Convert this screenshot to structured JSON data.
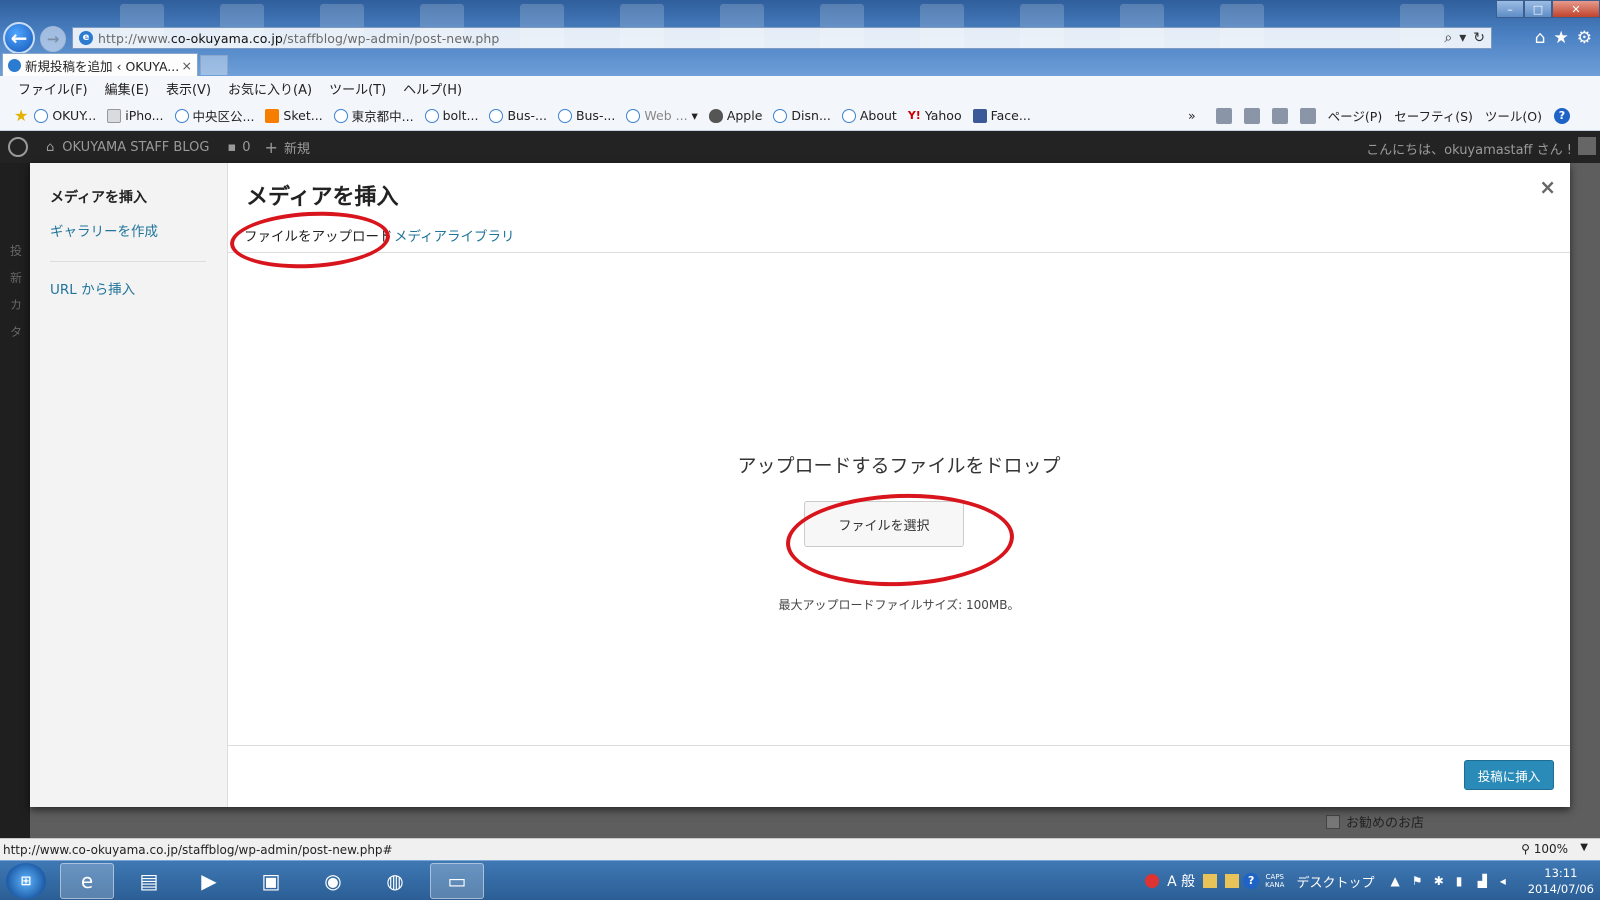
{
  "browser": {
    "address_url_prefix": "http://www.",
    "address_url_domain": "co-okuyama.co.jp",
    "address_url_path": "/staffblog/wp-admin/post-new.php",
    "tab_title": "新規投稿を追加 ‹ OKUYA...",
    "tab_close": "×",
    "window_buttons": [
      "–",
      "□",
      "✕"
    ],
    "menu": [
      "ファイル(F)",
      "編集(E)",
      "表示(V)",
      "お気に入り(A)",
      "ツール(T)",
      "ヘルプ(H)"
    ],
    "favorites": [
      {
        "label": "OKUY...",
        "icon": "ie-page-icon"
      },
      {
        "label": "iPho...",
        "icon": "document-icon"
      },
      {
        "label": "中央区公...",
        "icon": "ie-page-icon"
      },
      {
        "label": "Sket...",
        "icon": "blogger-icon"
      },
      {
        "label": "東京都中...",
        "icon": "ie-page-icon"
      },
      {
        "label": "bolt...",
        "icon": "ie-page-icon"
      },
      {
        "label": "Bus-...",
        "icon": "ie-page-icon"
      },
      {
        "label": "Bus-...",
        "icon": "ie-page-icon"
      },
      {
        "label": "Web ...",
        "icon": "ie-page-icon"
      },
      {
        "label": "Apple",
        "icon": "apple-icon"
      },
      {
        "label": "Disn...",
        "icon": "ie-page-icon"
      },
      {
        "label": "About",
        "icon": "ie-page-icon"
      },
      {
        "label": "Yahoo",
        "icon": "yahoo-icon"
      },
      {
        "label": "Face...",
        "icon": "facebook-icon"
      }
    ],
    "toolbar_right": {
      "page": "ページ(P)",
      "safety": "セーフティ(S)",
      "tools": "ツール(O)",
      "more": "»"
    },
    "status_url": "http://www.co-okuyama.co.jp/staffblog/wp-admin/post-new.php#",
    "zoom": "100%"
  },
  "wp_admin_bar": {
    "site_name": "OKUYAMA STAFF BLOG",
    "comments_count": "0",
    "new_label": "新規",
    "howdy": "こんにちは、okuyamastaff さん !"
  },
  "wp_sidebar_partial": [
    "投",
    "新",
    "カ",
    "タ"
  ],
  "background": {
    "checkbox_label": "お勧めのお店"
  },
  "media_modal": {
    "menu_title": "メディアを挿入",
    "menu_gallery": "ギャラリーを作成",
    "menu_url": "URL から挿入",
    "title": "メディアを挿入",
    "close": "×",
    "tab_upload": "ファイルをアップロード",
    "tab_library": "メディアライブラリ",
    "drop_text": "アップロードするファイルをドロップ",
    "select_button": "ファイルを選択",
    "max_size": "最大アップロードファイルサイズ: 100MB。",
    "insert_button": "投稿に挿入"
  },
  "annotation": {
    "color": "#d8141c"
  },
  "taskbar": {
    "tray_label": "デスクトップ",
    "ime": "A 般",
    "caps": "CAPS",
    "kana": "KANA",
    "time": "13:11",
    "date": "2014/07/06"
  }
}
